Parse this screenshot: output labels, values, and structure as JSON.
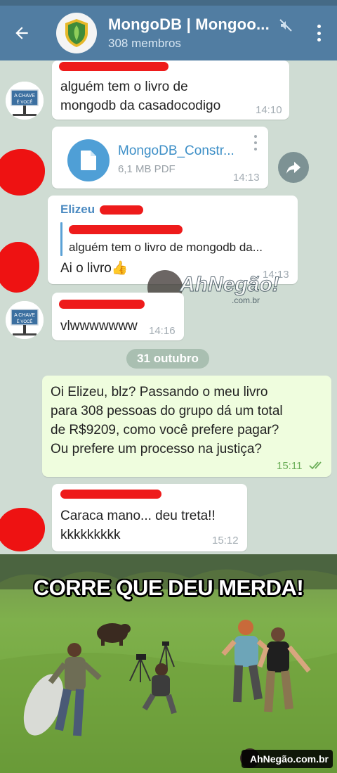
{
  "header": {
    "title": "MongoDB | Mongoo...",
    "subtitle": "308 membros"
  },
  "messages": [
    {
      "type": "text",
      "text_lines": [
        "alguém tem o livro de",
        "mongodb da casadocodigo"
      ],
      "time": "14:10"
    },
    {
      "type": "file",
      "file_name": "MongoDB_Constr...",
      "file_info": "6,1 MB PDF",
      "time": "14:13"
    },
    {
      "type": "reply",
      "sender": "Elizeu",
      "quoted_text": "alguém tem o livro de mongodb da...",
      "text": "Ai o livro👍",
      "time": "14:13"
    },
    {
      "type": "text",
      "text": "vlwwwwwww",
      "time": "14:16"
    },
    {
      "type": "date",
      "label": "31 outubro"
    },
    {
      "type": "outgoing",
      "text_lines": [
        "Oi Elizeu, blz? Passando o meu livro",
        "para 308 pessoas do grupo dá um total",
        "de R$9209, como você prefere pagar?",
        "Ou prefere um processo na justiça?"
      ],
      "time": "15:11"
    },
    {
      "type": "text",
      "text_lines": [
        "Caraca mano... deu treta!!",
        "kkkkkkkkk"
      ],
      "time": "15:12"
    }
  ],
  "avatar_sign": {
    "line1": "A CHAVE",
    "line2": "É VOCÊ"
  },
  "watermark": {
    "brand": "AhNegão!",
    "domain": ".com.br"
  },
  "meme": {
    "caption": "CORRE QUE DEU MERDA!",
    "badge": "AhNegão.com.br"
  },
  "colors": {
    "appbar": "#517da2",
    "link": "#3d8fc7",
    "outgoing_bubble": "#effdde",
    "redaction": "#ee1b1b"
  },
  "icons": [
    "back-arrow-icon",
    "shield-leaf-icon",
    "mute-icon",
    "more-vert-icon",
    "file-icon",
    "share-icon",
    "double-check-icon"
  ]
}
